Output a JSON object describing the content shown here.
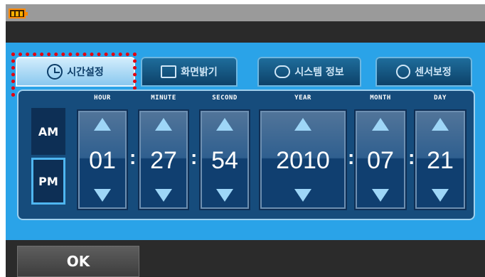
{
  "status_bar": {
    "battery_icon": "battery-icon"
  },
  "tabs": [
    {
      "label": "시간설정",
      "icon": "clock-icon",
      "active": true
    },
    {
      "label": "화면밝기",
      "icon": "monitor-icon",
      "active": false
    },
    {
      "label": "시스템 정보",
      "icon": "speech-bubble-icon",
      "active": false
    },
    {
      "label": "센서보정",
      "icon": "refresh-icon",
      "active": false
    }
  ],
  "time_setting": {
    "am_label": "AM",
    "pm_label": "PM",
    "selected_period": "PM",
    "fields": [
      {
        "name": "HOUR",
        "value": "01"
      },
      {
        "name": "MINUTE",
        "value": "27"
      },
      {
        "name": "SECOND",
        "value": "54"
      },
      {
        "name": "YEAR",
        "value": "2010"
      },
      {
        "name": "MONTH",
        "value": "07"
      },
      {
        "name": "DAY",
        "value": "21"
      }
    ],
    "separator": ":"
  },
  "footer": {
    "ok_label": "OK"
  },
  "colors": {
    "accent_blue": "#2aa3e8",
    "panel_blue": "#164c7c",
    "highlight_red": "#e3000f",
    "battery_orange": "#ff8a00"
  }
}
